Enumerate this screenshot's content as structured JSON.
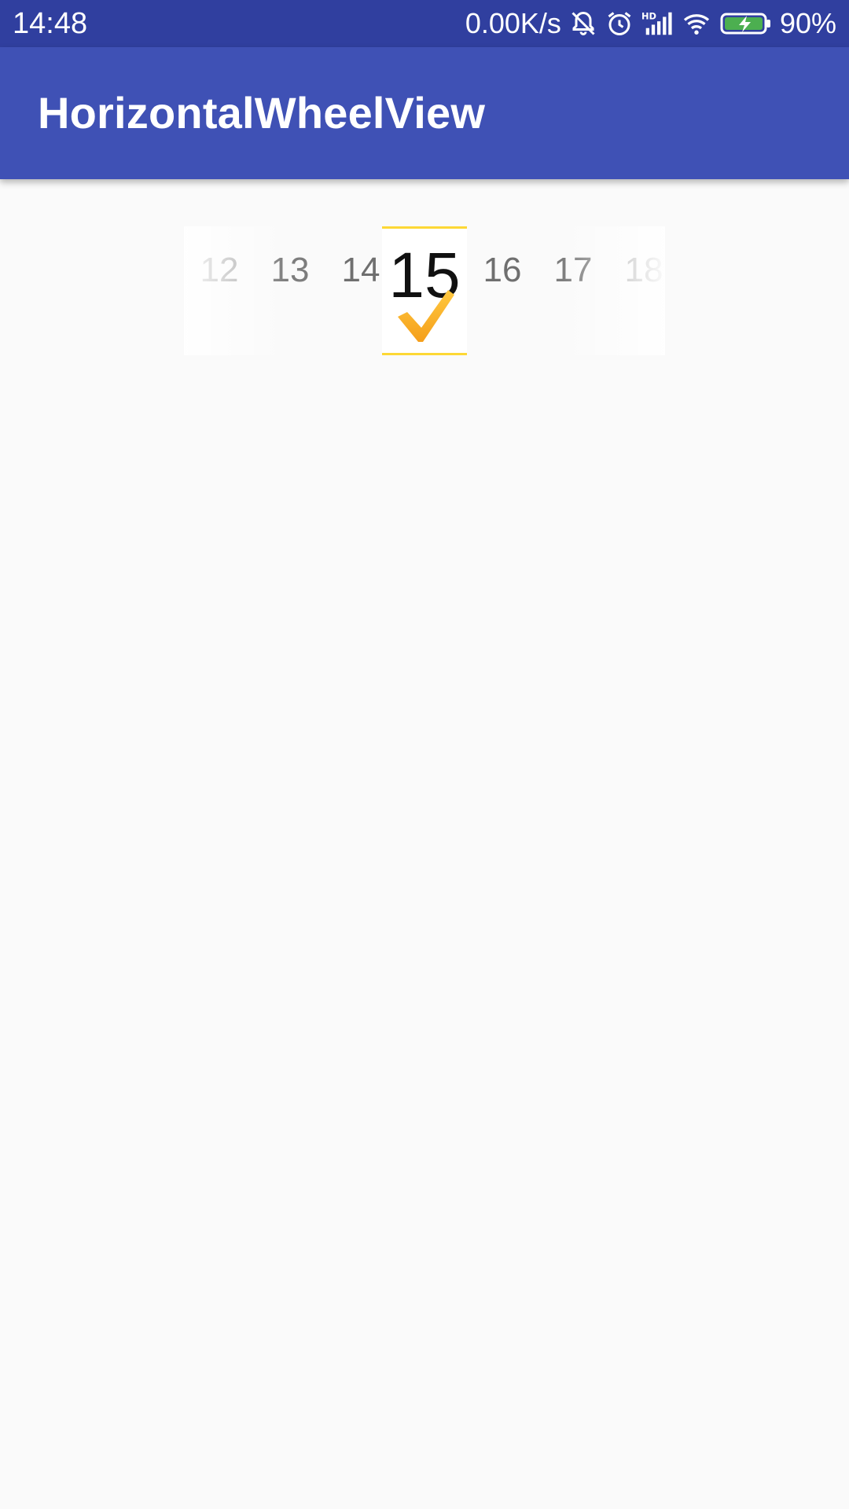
{
  "status_bar": {
    "time": "14:48",
    "net_speed": "0.00K/s",
    "battery_percent": "90%",
    "icons": [
      "alarm-off-icon",
      "alarm-clock-icon",
      "hd-signal-icon",
      "wifi-icon",
      "battery-charging-icon"
    ],
    "background_color": "#303f9f"
  },
  "app_bar": {
    "title": "HorizontalWheelView",
    "background_color": "#3f51b5"
  },
  "wheel": {
    "items": [
      "12",
      "13",
      "14",
      "16",
      "17",
      "18"
    ],
    "selected": "15",
    "selected_icon": "checkmark-icon",
    "accent_color": "#fdd835",
    "check_color": "#f9a825"
  }
}
